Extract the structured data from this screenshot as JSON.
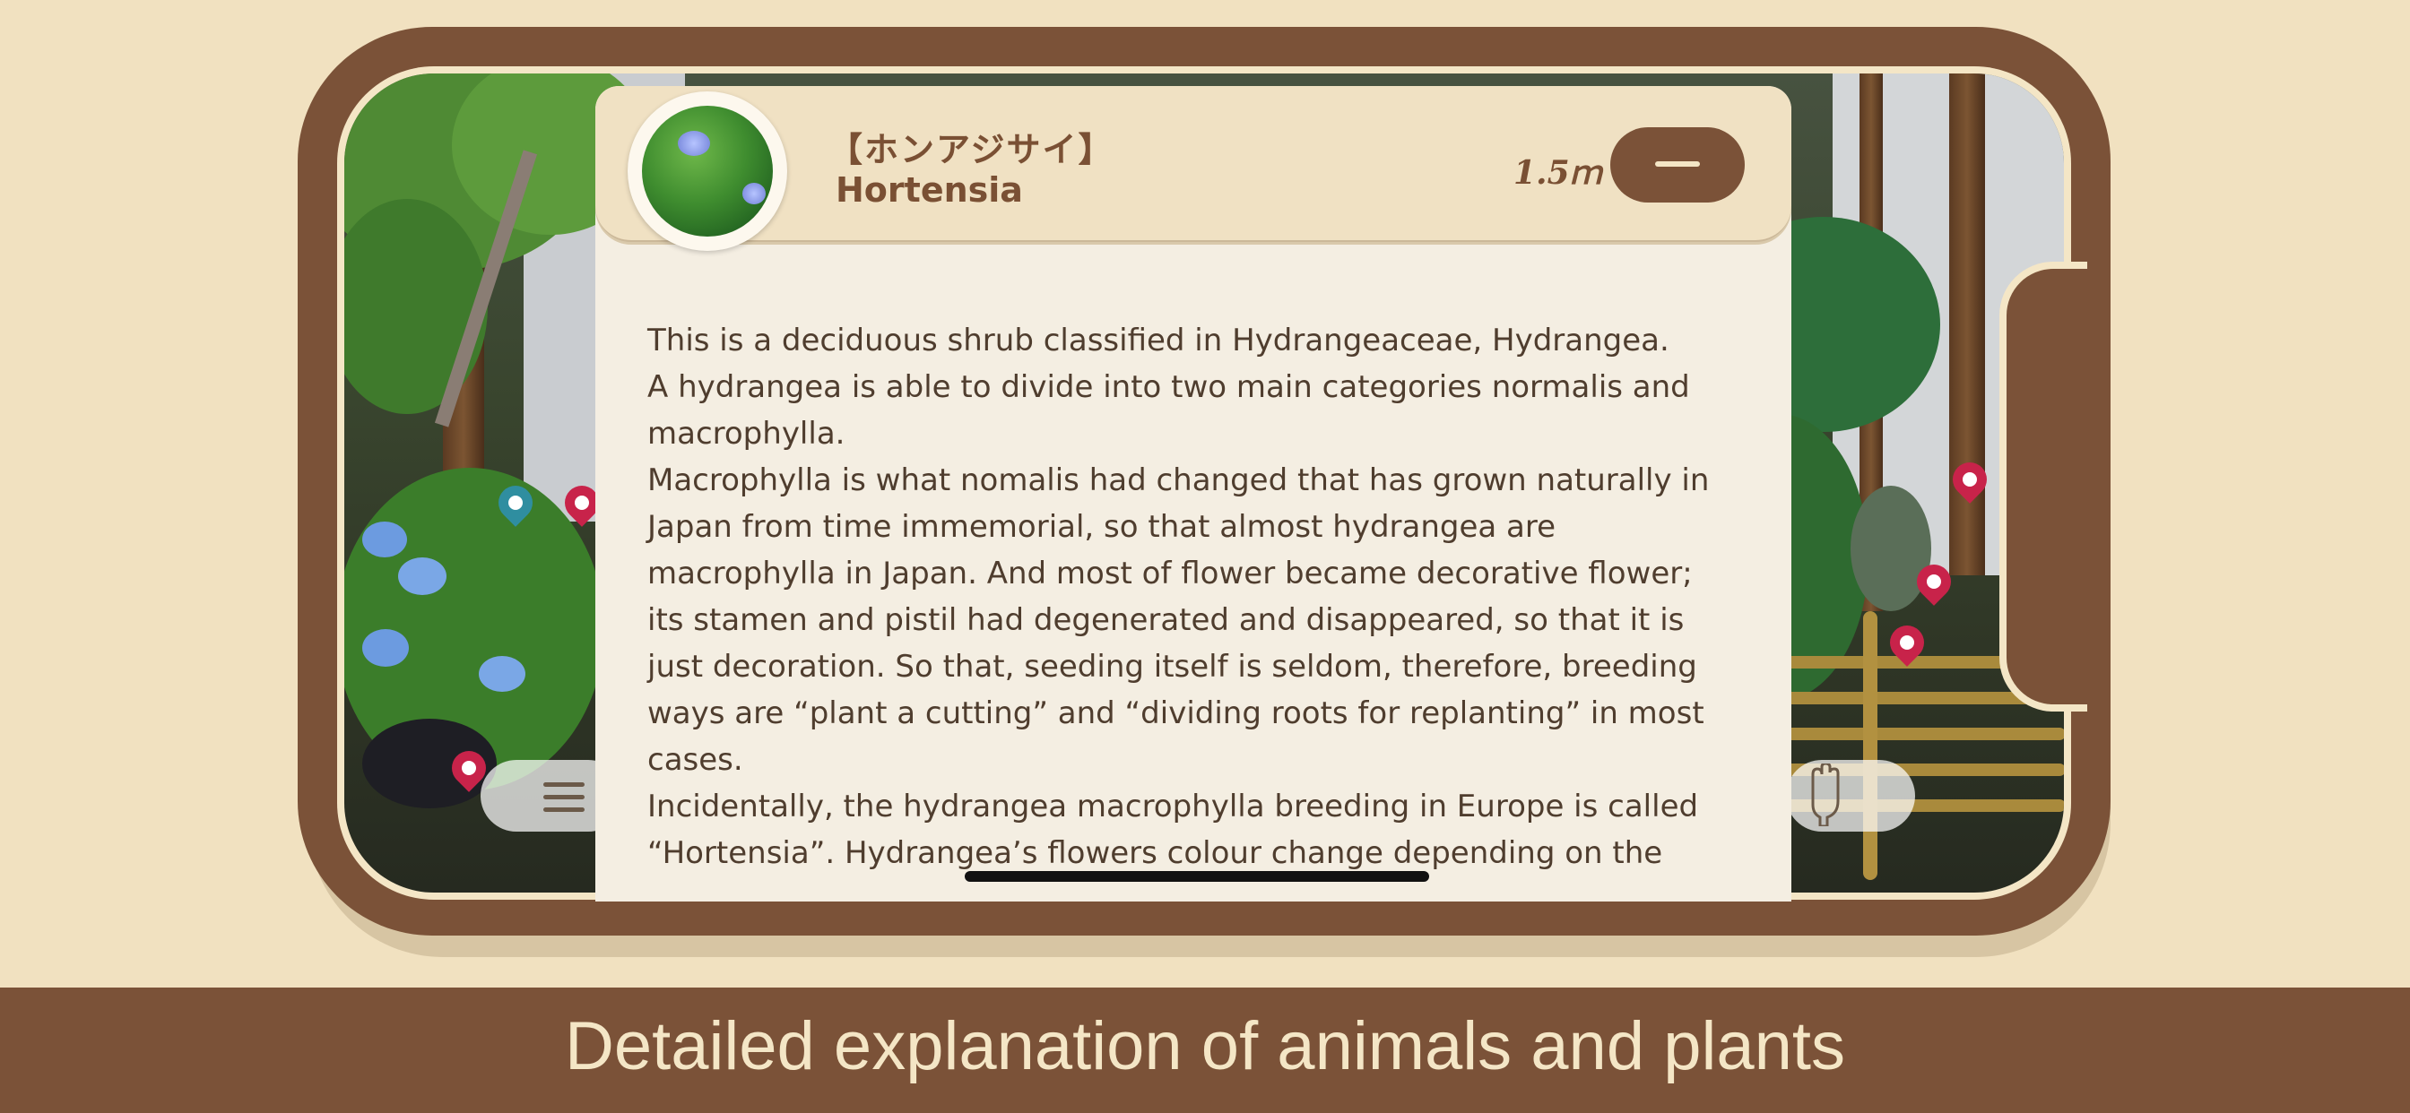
{
  "entry": {
    "name_jp": "【ホンアジサイ】",
    "name_en": "Hortensia",
    "height": "1.5ｍ",
    "description": "  This is a deciduous shrub classified in Hydrangeaceae, Hydrangea.\nA hydrangea is able to divide into two main categories normalis and\nmacrophylla.\n  Macrophylla is what nomalis had changed that has grown naturally in\nJapan from time immemorial, so that almost hydrangea are\nmacrophylla in Japan.  And most of flower became decorative flower;\nits stamen and pistil had degenerated and disappeared, so that it is\njust decoration.  So that, seeding itself is seldom, therefore, breeding\nways are “plant a cutting” and “dividing roots for replanting” in most\ncases.\n Incidentally, the hydrangea macrophylla breeding in Europe is called\n“Hortensia”.  Hydrangea’s flowers colour change depending on the"
  },
  "icons": {
    "close": "minus-icon",
    "menu": "menu-lines-icon",
    "tool": "glove-icon",
    "marker": "map-pin-icon"
  },
  "caption": "Detailed explanation of animals and plants",
  "colors": {
    "background": "#f1e1c0",
    "frame_brown": "#7b5238",
    "panel_header": "#f0e1c3",
    "panel_body": "#f4eee2",
    "text_brown": "#7a5034",
    "pin_teal": "#2f8ea0",
    "pin_red": "#c8234a"
  }
}
